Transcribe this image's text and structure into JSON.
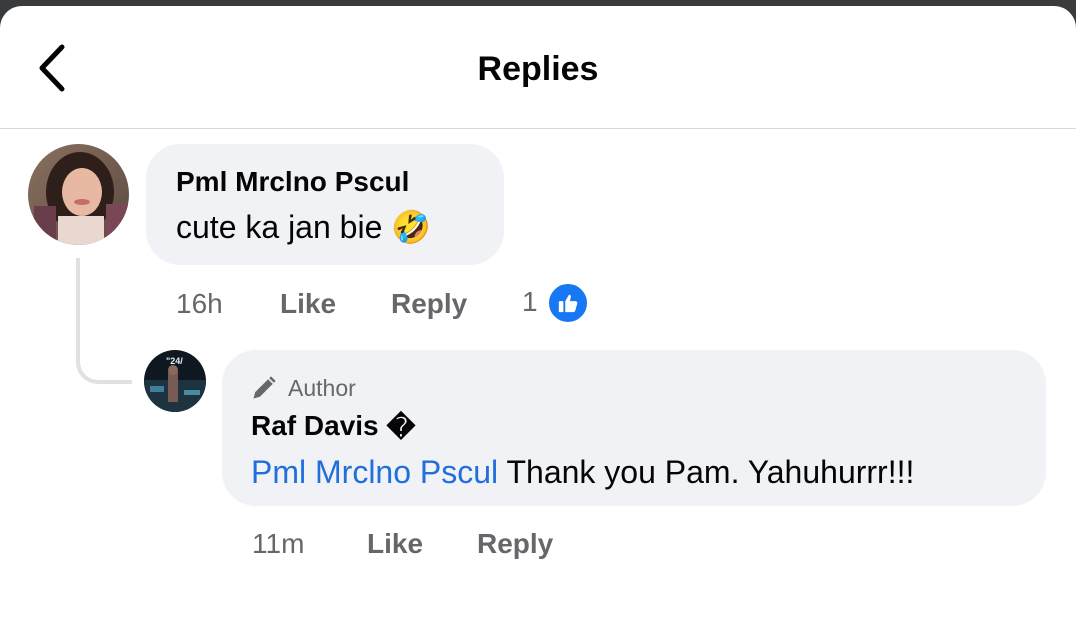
{
  "header": {
    "title": "Replies"
  },
  "comment": {
    "author": "Pml Mrclno Pscul",
    "text": "cute ka jan bie",
    "emoji": "🤣",
    "time": "16h",
    "like_label": "Like",
    "reply_label": "Reply",
    "reaction_count": "1",
    "reaction_icon": "like-thumb-icon"
  },
  "reply": {
    "badge": "Author",
    "author": "Raf Davis",
    "author_glyph": "�",
    "mention": "Pml Mrclno Pscul",
    "text": " Thank you Pam. Yahuhurrr!!!",
    "time": "11m",
    "like_label": "Like",
    "reply_label": "Reply"
  },
  "colors": {
    "mention": "#216fdb",
    "like_badge": "#1877f2",
    "bubble": "#f0f2f5",
    "meta": "#65676b"
  }
}
